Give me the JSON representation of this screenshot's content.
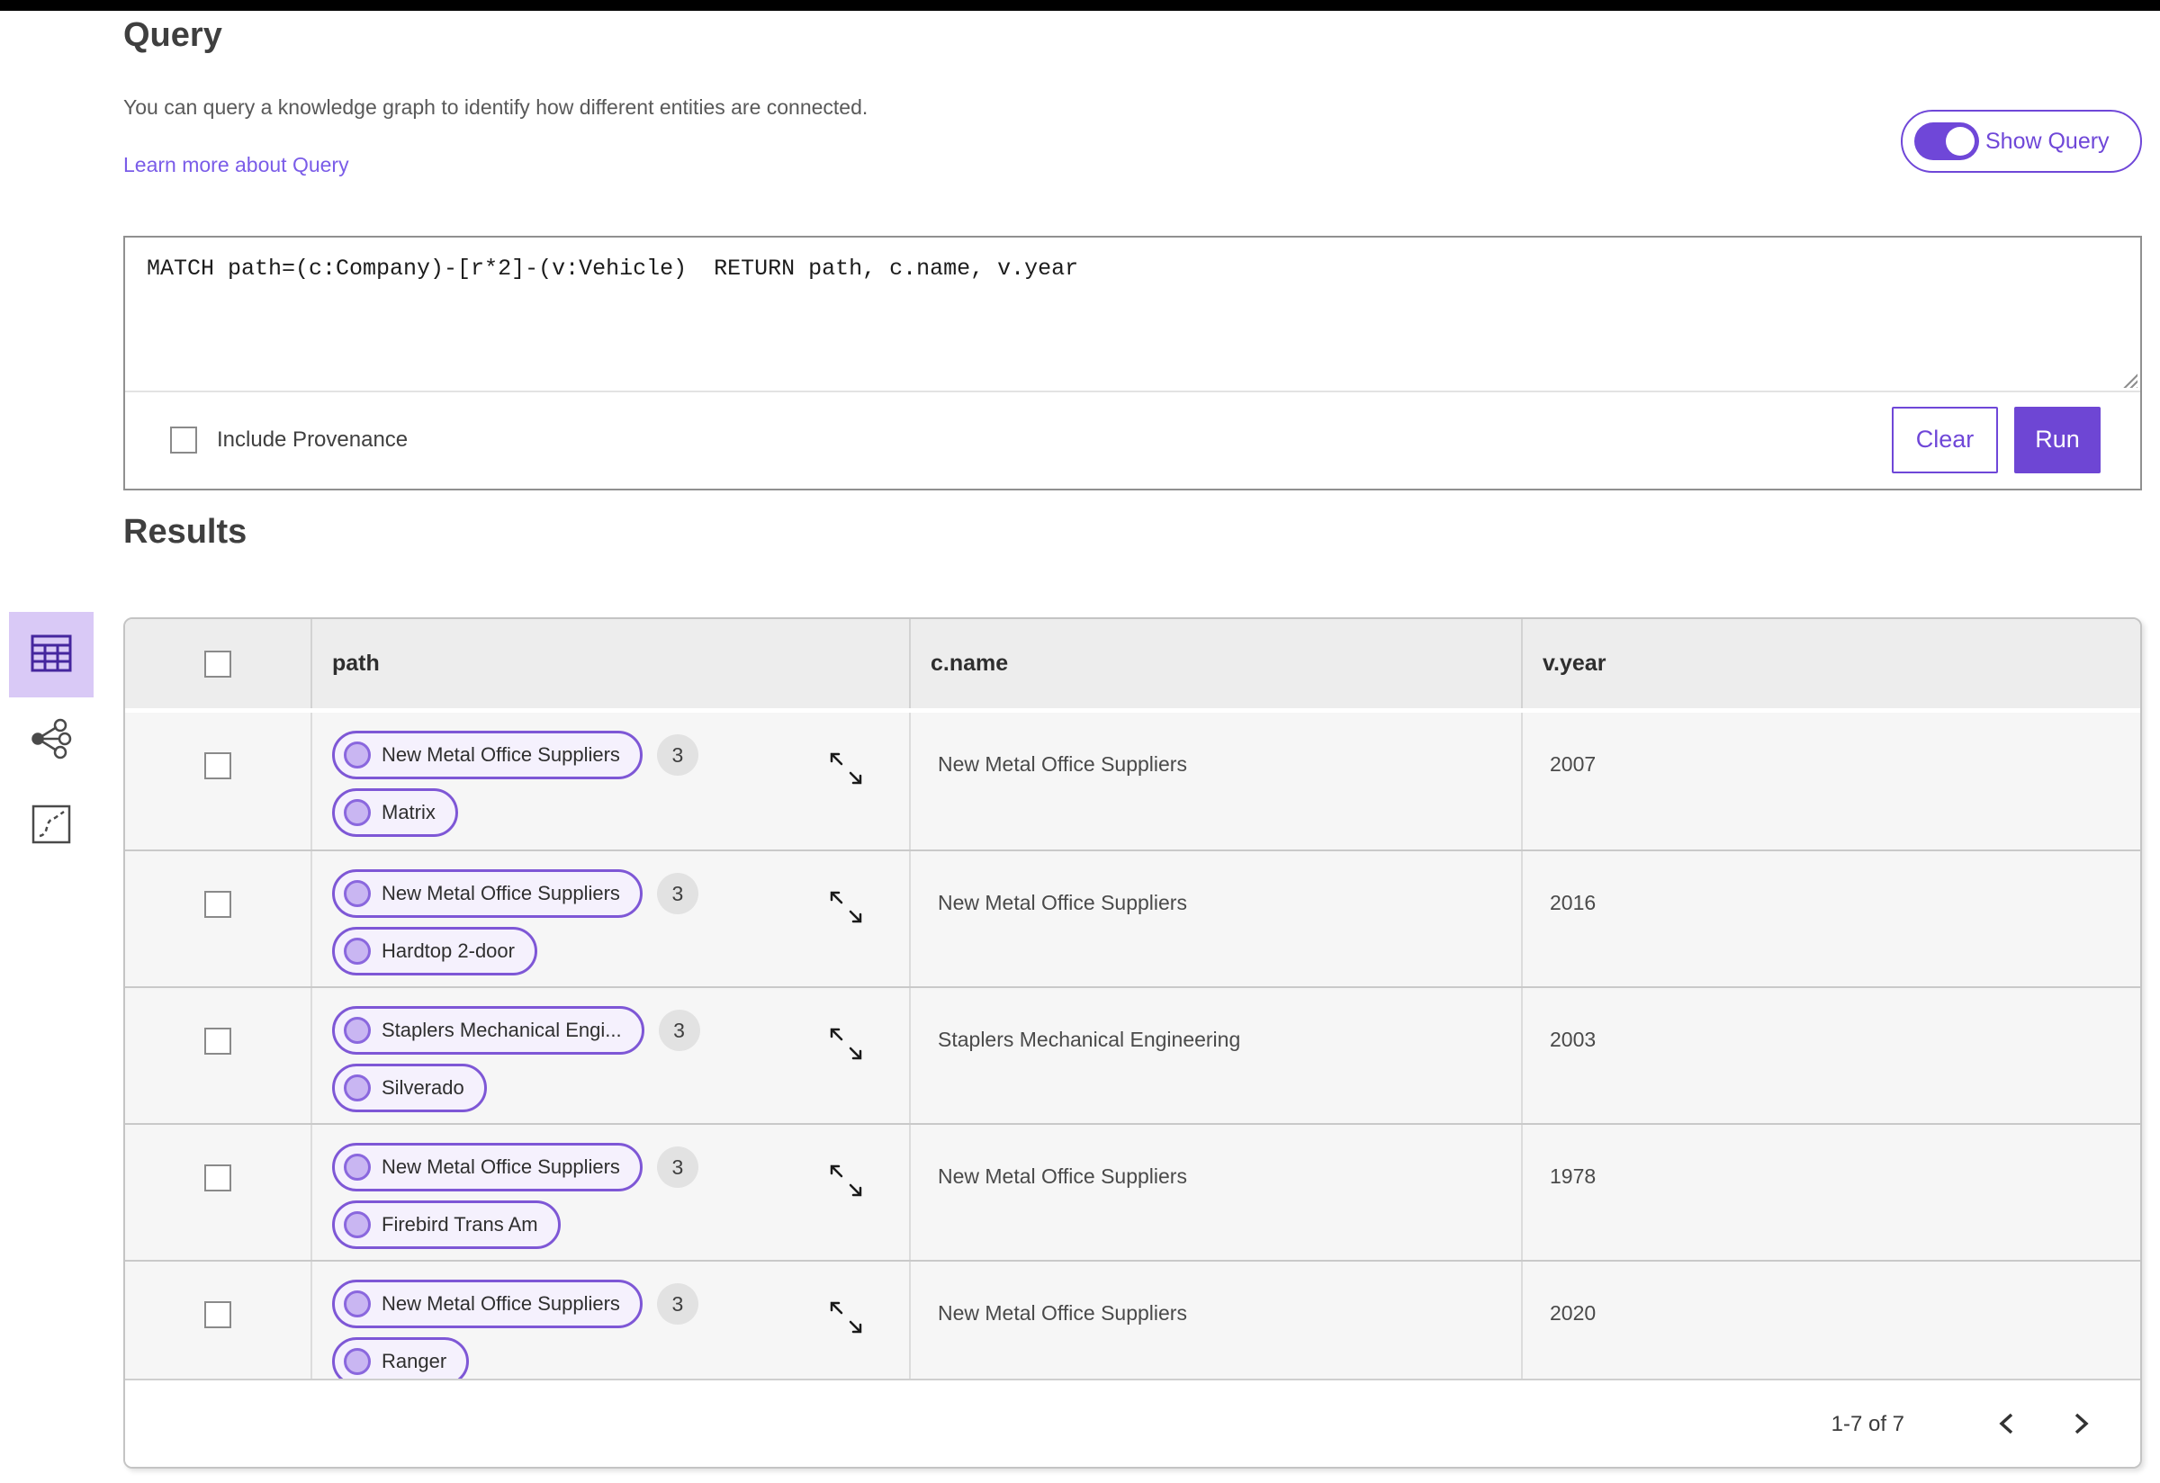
{
  "page": {
    "title": "Query",
    "description": "You can query a knowledge graph to identify how different entities are connected.",
    "learn_more_label": "Learn more about Query",
    "show_query_label": "Show Query",
    "show_query_state": "on"
  },
  "query_editor": {
    "query_text": "MATCH path=(c:Company)-[r*2]-(v:Vehicle)  RETURN path, c.name, v.year",
    "include_provenance_label": "Include Provenance",
    "include_provenance_checked": false,
    "clear_label": "Clear",
    "run_label": "Run"
  },
  "results": {
    "heading": "Results",
    "view_switcher": {
      "options": [
        "table-view-icon",
        "network-view-icon",
        "route-view-icon"
      ],
      "active": "table-view-icon"
    },
    "table": {
      "columns": {
        "path": "path",
        "c_name": "c.name",
        "v_year": "v.year"
      },
      "rows": [
        {
          "path_start": "New Metal Office Suppliers",
          "badge": "3",
          "path_end": "Matrix",
          "c_name": "New Metal Office Suppliers",
          "v_year": "2007"
        },
        {
          "path_start": "New Metal Office Suppliers",
          "badge": "3",
          "path_end": "Hardtop 2-door",
          "c_name": "New Metal Office Suppliers",
          "v_year": "2016"
        },
        {
          "path_start": "Staplers Mechanical Engi...",
          "badge": "3",
          "path_end": "Silverado",
          "c_name": "Staplers Mechanical Engineering",
          "v_year": "2003"
        },
        {
          "path_start": "New Metal Office Suppliers",
          "badge": "3",
          "path_end": "Firebird Trans Am",
          "c_name": "New Metal Office Suppliers",
          "v_year": "1978"
        },
        {
          "path_start": "New Metal Office Suppliers",
          "badge": "3",
          "path_end": "Ranger",
          "c_name": "New Metal Office Suppliers",
          "v_year": "2020"
        }
      ],
      "pagination": {
        "range_label": "1-7 of 7"
      }
    }
  },
  "colors": {
    "accent_purple": "#6f47d8",
    "run_button": "#6e46d4",
    "pill_border": "#7e57d6",
    "pill_background": "#f5f1fd",
    "pill_dot": "#c9b6f2",
    "active_view_background": "#d9c9f6",
    "header_row_background": "#ededed",
    "row_background": "#f6f6f6",
    "badge_background": "#e2e2e2",
    "top_bar": "#000000"
  }
}
